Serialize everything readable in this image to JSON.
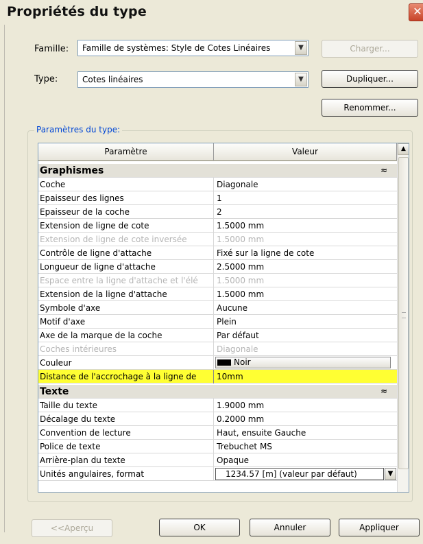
{
  "window": {
    "title": "Propriétés du type",
    "close_symbol": "✕"
  },
  "famille": {
    "label": "Famille:",
    "value": "Famille de systèmes: Style de Cotes Linéaires"
  },
  "type": {
    "label": "Type:",
    "value": "Cotes linéaires"
  },
  "buttons": {
    "charger": "Charger...",
    "dupliquer": "Dupliquer...",
    "renommer": "Renommer...",
    "apercu": "<<Aperçu",
    "ok": "OK",
    "annuler": "Annuler",
    "appliquer": "Appliquer"
  },
  "params": {
    "group_label": "Paramètres du type:",
    "col_param": "Paramètre",
    "col_value": "Valeur",
    "groups": [
      {
        "name": "Graphismes",
        "rows": [
          {
            "p": "Coche",
            "v": "Diagonale"
          },
          {
            "p": "Epaisseur des lignes",
            "v": "1"
          },
          {
            "p": "Epaisseur de la coche",
            "v": "2"
          },
          {
            "p": "Extension de ligne de cote",
            "v": "1.5000 mm"
          },
          {
            "p": "Extension de ligne de cote inversée",
            "v": "1.5000 mm",
            "disabled": true
          },
          {
            "p": "Contrôle de ligne d'attache",
            "v": "Fixé sur la ligne de cote"
          },
          {
            "p": "Longueur de ligne d'attache",
            "v": "2.5000 mm"
          },
          {
            "p": "Espace entre la ligne d'attache et l'élé",
            "v": "1.5000 mm",
            "disabled": true
          },
          {
            "p": "Extension de la ligne d'attache",
            "v": "1.5000 mm"
          },
          {
            "p": "Symbole d'axe",
            "v": "Aucune"
          },
          {
            "p": "Motif d'axe",
            "v": "Plein"
          },
          {
            "p": "Axe de la marque de la coche",
            "v": "Par défaut"
          },
          {
            "p": "Coches intérieures",
            "v": "Diagonale",
            "disabled": true
          },
          {
            "p": "Couleur",
            "v": "Noir"
          },
          {
            "p": "Distance de l'accrochage à la ligne de",
            "v": "10mm"
          }
        ]
      },
      {
        "name": "Texte",
        "rows": [
          {
            "p": "Taille du texte",
            "v": "1.9000 mm"
          },
          {
            "p": "Décalage du texte",
            "v": "0.2000 mm"
          },
          {
            "p": "Convention de lecture",
            "v": "Haut, ensuite Gauche"
          },
          {
            "p": "Police de texte",
            "v": "Trebuchet MS"
          },
          {
            "p": "Arrière-plan du texte",
            "v": "Opaque"
          },
          {
            "p": "Unités angulaires, format",
            "v": "1234.57 [m] (valeur par défaut)"
          }
        ]
      }
    ]
  }
}
